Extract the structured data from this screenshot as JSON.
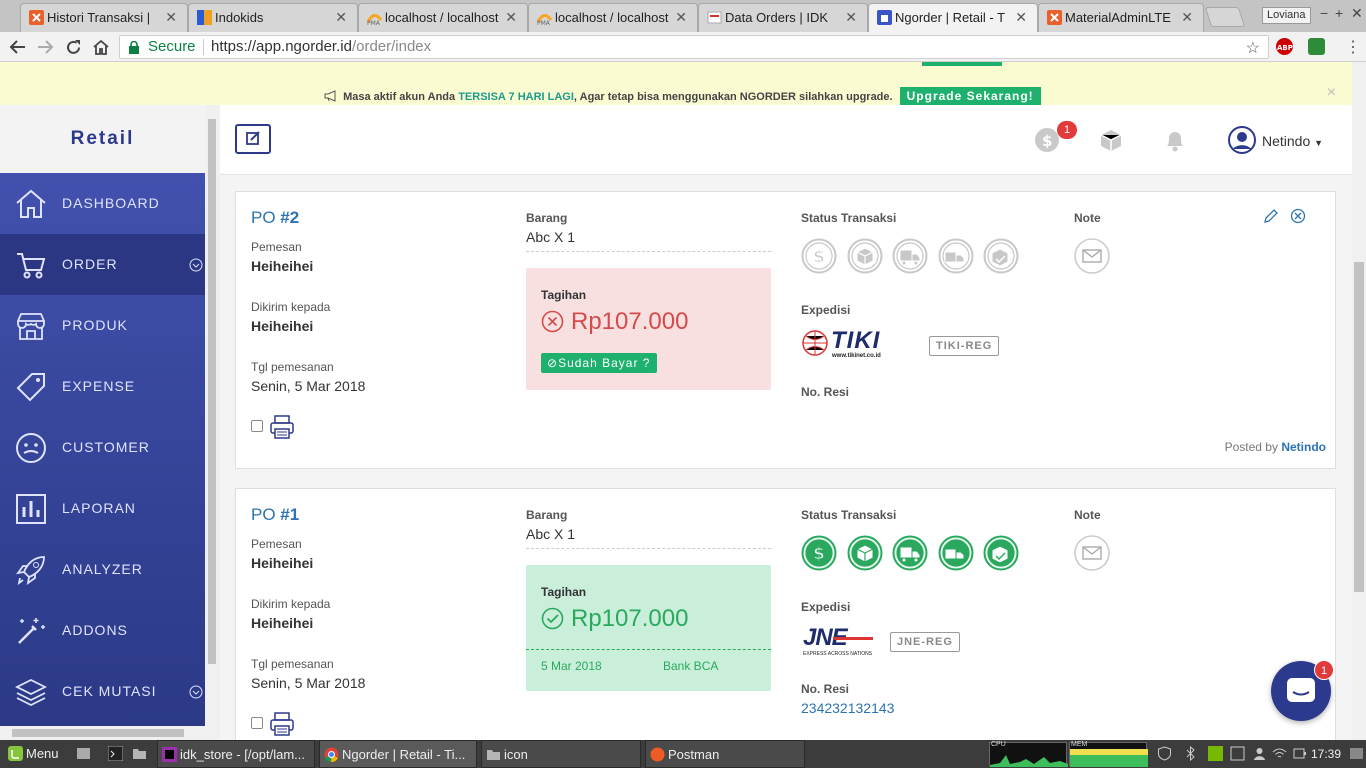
{
  "browser": {
    "tabs": [
      {
        "label": "Histori Transaksi |",
        "favicon": "xampp-icon",
        "color": "#e8612c"
      },
      {
        "label": "Indokids",
        "favicon": "indokids-icon",
        "color": "#f0a020"
      },
      {
        "label": "localhost / localhost",
        "favicon": "phpmyadmin-icon",
        "color": "#f5a623"
      },
      {
        "label": "localhost / localhost",
        "favicon": "phpmyadmin-icon",
        "color": "#f5a623"
      },
      {
        "label": "Data Orders | IDK",
        "favicon": "page-icon",
        "color": "#cc3333"
      },
      {
        "label": "Ngorder | Retail - T",
        "favicon": "ngorder-icon",
        "color": "#3a55c8",
        "active": true
      },
      {
        "label": "MaterialAdminLTE",
        "favicon": "xampp-icon",
        "color": "#e8612c"
      }
    ],
    "user": "Loviana",
    "secure_label": "Secure",
    "url_host": "https://app.ngorder.id",
    "url_path": "/order/index"
  },
  "banner": {
    "prefix": "Masa aktif akun Anda",
    "highlight": "TERSISA 7 HARI LAGI",
    "suffix": ", Agar tetap bisa menggunakan NGORDER silahkan upgrade.",
    "button": "Upgrade Sekarang!",
    "close": "×"
  },
  "sidebar": {
    "brand": "Retail",
    "items": [
      {
        "label": "DASHBOARD",
        "icon": "home-icon"
      },
      {
        "label": "ORDER",
        "icon": "cart-icon",
        "active": true,
        "expandable": true
      },
      {
        "label": "PRODUK",
        "icon": "store-icon"
      },
      {
        "label": "EXPENSE",
        "icon": "tag-icon"
      },
      {
        "label": "CUSTOMER",
        "icon": "face-icon"
      },
      {
        "label": "LAPORAN",
        "icon": "bar-chart-icon"
      },
      {
        "label": "ANALYZER",
        "icon": "rocket-icon"
      },
      {
        "label": "ADDONS",
        "icon": "magic-wand-icon"
      },
      {
        "label": "CEK MUTASI",
        "icon": "layers-icon",
        "expandable": true
      }
    ]
  },
  "header": {
    "billing_badge": "1",
    "username": "Netindo"
  },
  "orders": [
    {
      "po_prefix": "PO ",
      "po_number": "#2",
      "pemesan_label": "Pemesan",
      "pemesan": "Heiheihei",
      "dikirim_label": "Dikirim kepada",
      "dikirim": "Heiheihei",
      "tgl_label": "Tgl pemesanan",
      "tgl": "Senin, 5 Mar 2018",
      "barang_label": "Barang",
      "barang": "Abc X 1",
      "tagihan_label": "Tagihan",
      "amount": "Rp107.000",
      "paid": false,
      "pay_button": "Sudah Bayar ?",
      "status_label": "Status Transaksi",
      "status_done": 0,
      "note_label": "Note",
      "expedisi_label": "Expedisi",
      "courier_logo": "TIKI",
      "courier_sub": "www.tikinet.co.id",
      "courier_service": "TIKI-REG",
      "resi_label": "No. Resi",
      "resi": "",
      "posted_prefix": "Posted by",
      "posted_by": "Netindo"
    },
    {
      "po_prefix": "PO ",
      "po_number": "#1",
      "pemesan_label": "Pemesan",
      "pemesan": "Heiheihei",
      "dikirim_label": "Dikirim kepada",
      "dikirim": "Heiheihei",
      "tgl_label": "Tgl pemesanan",
      "tgl": "Senin, 5 Mar 2018",
      "barang_label": "Barang",
      "barang": "Abc X 1",
      "tagihan_label": "Tagihan",
      "amount": "Rp107.000",
      "paid": true,
      "paid_date": "5 Mar 2018",
      "paid_bank": "Bank BCA",
      "status_label": "Status Transaksi",
      "status_done": 5,
      "note_label": "Note",
      "expedisi_label": "Expedisi",
      "courier_logo": "JNE",
      "courier_sub": "EXPRESS ACROSS NATIONS",
      "courier_service": "JNE-REG",
      "resi_label": "No. Resi",
      "resi": "234232132143"
    }
  ],
  "chat_badge": "1",
  "taskbar": {
    "menu": "Menu",
    "windows": [
      "idk_store - [/opt/lam...",
      "Ngorder | Retail - Ti...",
      "icon",
      "Postman"
    ],
    "graph_labels": [
      "CPU",
      "MEM"
    ],
    "clock": "17:39"
  },
  "colors": {
    "accent": "#2d3a8c",
    "success": "#1eb16e",
    "danger": "#d64a4a",
    "link": "#2d73b4"
  }
}
